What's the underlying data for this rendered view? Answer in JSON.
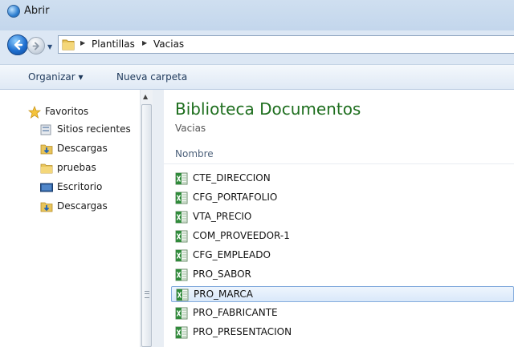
{
  "window": {
    "title": "Abrir"
  },
  "address": {
    "crumbs": [
      "Plantillas",
      "Vacias"
    ]
  },
  "commandbar": {
    "organize_label": "Organizar ▾",
    "new_folder_label": "Nueva carpeta"
  },
  "navpane": {
    "favorites_label": "Favoritos",
    "items": [
      {
        "label": "Sitios recientes",
        "icon": "recent-places-icon"
      },
      {
        "label": "Descargas",
        "icon": "downloads-folder-icon"
      },
      {
        "label": "pruebas",
        "icon": "folder-icon"
      },
      {
        "label": "Escritorio",
        "icon": "desktop-icon"
      },
      {
        "label": "Descargas",
        "icon": "downloads-folder-icon"
      }
    ]
  },
  "main": {
    "library_title": "Biblioteca Documentos",
    "library_subtitle": "Vacias",
    "column_header": "Nombre",
    "files": [
      {
        "name": "CTE_DIRECCION",
        "selected": false
      },
      {
        "name": "CFG_PORTAFOLIO",
        "selected": false
      },
      {
        "name": "VTA_PRECIO",
        "selected": false
      },
      {
        "name": "COM_PROVEEDOR-1",
        "selected": false
      },
      {
        "name": "CFG_EMPLEADO",
        "selected": false
      },
      {
        "name": "PRO_SABOR",
        "selected": false
      },
      {
        "name": "PRO_MARCA",
        "selected": true
      },
      {
        "name": "PRO_FABRICANTE",
        "selected": false
      },
      {
        "name": "PRO_PRESENTACION",
        "selected": false
      }
    ]
  },
  "colors": {
    "library_title": "#1e6e1e",
    "selection_border": "#84acdd"
  }
}
